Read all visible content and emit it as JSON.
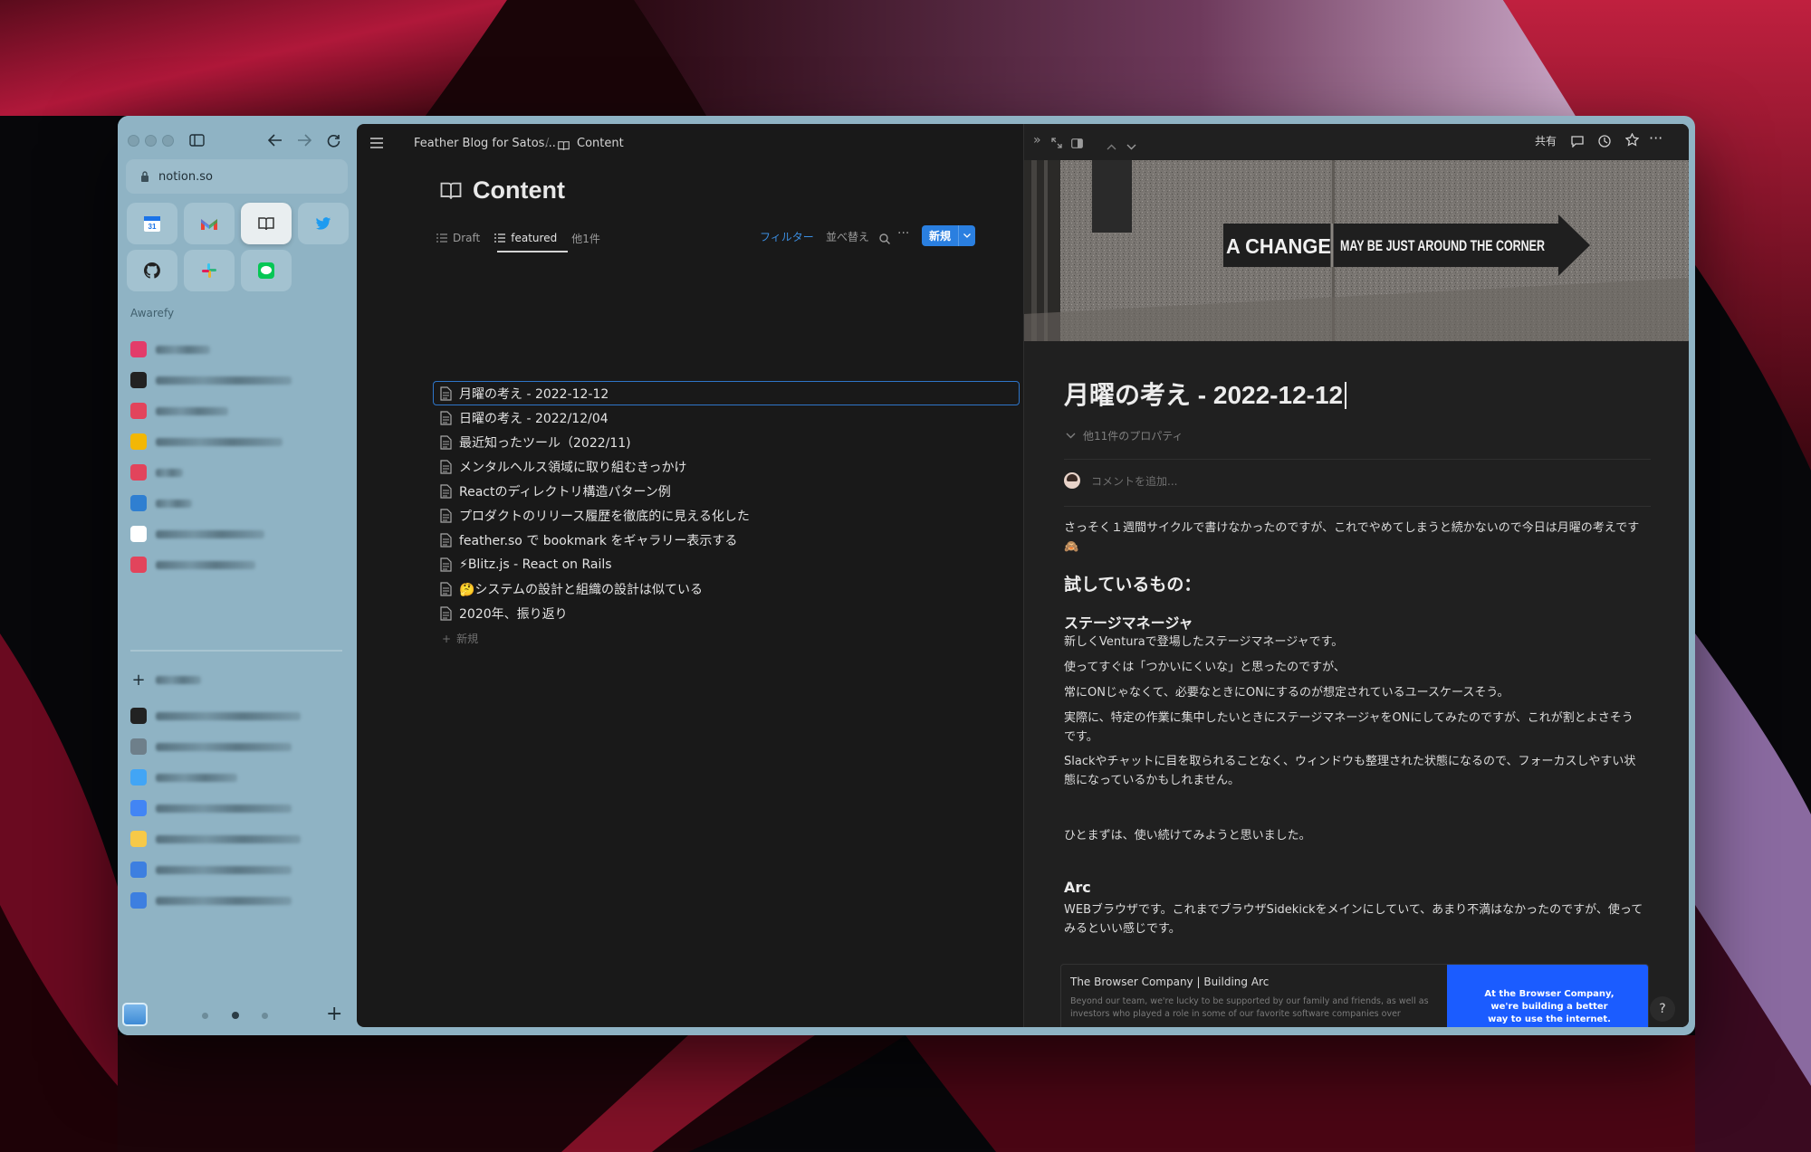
{
  "browser": {
    "url": "notion.so",
    "space_label": "Awarefy",
    "favorites": [
      {
        "icon": "calendar-icon",
        "color": "#1a73e8"
      },
      {
        "icon": "gmail-icon",
        "color": "#ea4335"
      },
      {
        "icon": "book-icon",
        "color": "#333333"
      },
      {
        "icon": "twitter-icon",
        "color": "#1d9bf0"
      },
      {
        "icon": "github-icon",
        "color": "#222222"
      },
      {
        "icon": "slack-icon",
        "color": "#e01e5a"
      },
      {
        "icon": "line-icon",
        "color": "#06c755"
      }
    ],
    "tabs": [
      {
        "icon": "heart-icon",
        "color": "#e33c6a"
      },
      {
        "icon": "github-icon",
        "color": "#222222"
      },
      {
        "icon": "chart-icon",
        "color": "#e2445c"
      },
      {
        "icon": "circle-app-icon",
        "color": "#f2b705"
      },
      {
        "icon": "chart-icon",
        "color": "#e2445c"
      },
      {
        "icon": "folder-icon",
        "color": "#2f7fd1"
      },
      {
        "icon": "spinner-icon",
        "color": "#ffffff"
      },
      {
        "icon": "chart-icon",
        "color": "#e2445c"
      }
    ],
    "pinned_tabs": [
      {
        "icon": "github-icon",
        "color": "#222222"
      },
      {
        "icon": "github-dark-icon",
        "color": "#6e7f8a"
      },
      {
        "icon": "flutter-icon",
        "color": "#42a5f5"
      },
      {
        "icon": "google-icon",
        "color": "#4285f4"
      },
      {
        "icon": "emoji-icon",
        "color": "#f7c948"
      },
      {
        "icon": "slash-icon",
        "color": "#3d7fe0"
      },
      {
        "icon": "slash-icon",
        "color": "#3d7fe0"
      }
    ]
  },
  "notion": {
    "breadcrumb": [
      "Feather Blog for Satos...",
      "Content"
    ],
    "database": {
      "title": "Content",
      "views": [
        "Draft",
        "featured",
        "他1件"
      ],
      "actions": {
        "filter": "フィルター",
        "sort": "並べ替え",
        "new": "新規"
      },
      "rows": [
        "月曜の考え - 2022-12-12",
        "日曜の考え - 2022/12/04",
        "最近知ったツール（2022/11)",
        "メンタルヘルス領域に取り組むきっかけ",
        "Reactのディレクトリ構造パターン例",
        "プロダクトのリリース履歴を徹底的に見える化した",
        "feather.so で bookmark をギャラリー表示する",
        "⚡Blitz.js - React on Rails",
        "🤔システムの設計と組織の設計は似ている",
        "2020年、振り返り"
      ],
      "add_row": "新規"
    },
    "peek": {
      "share": "共有",
      "cover_text_left": "A CHANGE",
      "cover_text_right": "MAY BE JUST AROUND THE CORNER",
      "title": "月曜の考え - 2022-12-12",
      "properties_toggle": "他11件のプロパティ",
      "comment_placeholder": "コメントを追加...",
      "intro": "さっそく１週間サイクルで書けなかったのですが、これでやめてしまうと続かないので今日は月曜の考えです🙈",
      "h2": "試しているもの：",
      "h3_stage": "ステージマネージャ",
      "stage_lines": [
        "新しくVenturaで登場したステージマネージャです。",
        "使ってすぐは「つかいにくいな」と思ったのですが、",
        "常にONじゃなくて、必要なときにONにするのが想定されているユースケースそう。",
        "実際に、特定の作業に集中したいときにステージマネージャをONにしてみたのですが、これが割とよさそうです。",
        "Slackやチャットに目を取られることなく、ウィンドウも整理された状態になるので、フォーカスしやすい状態になっているかもしれません。"
      ],
      "stage_conclusion": "ひとまずは、使い続けてみようと思いました。",
      "h3_arc": "Arc",
      "arc_text": "WEBブラウザです。これまでブラウザSidekickをメインにしていて、あまり不満はなかったのですが、使ってみるといい感じです。",
      "bookmark": {
        "title": "The Browser Company | Building Arc",
        "description": "Beyond our team, we're lucky to be supported by our family and friends, as well as investors who played a role in some of our favorite software companies over",
        "image_text": "At the Browser Company, we're building a better way to use the internet."
      },
      "help": "?"
    }
  }
}
